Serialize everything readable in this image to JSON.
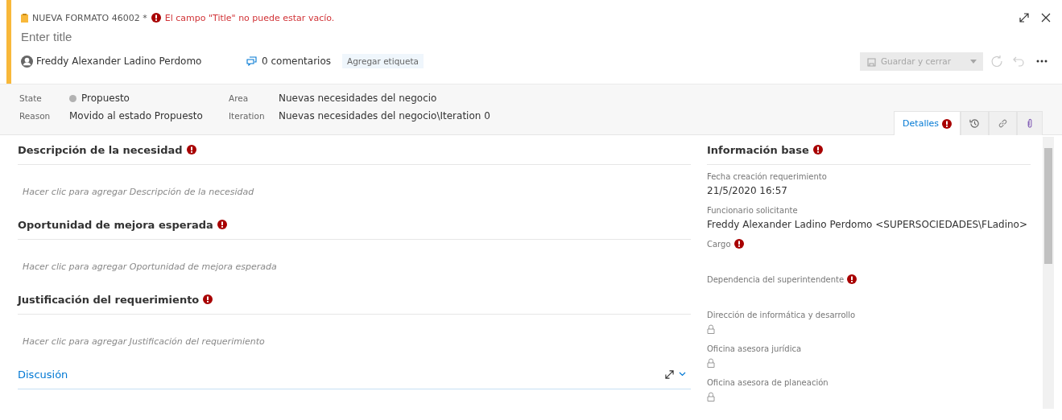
{
  "header": {
    "work_item_label": "NUEVA FORMATO 46002 *",
    "error": "El campo \"Title\" no puede estar vacío.",
    "title_placeholder": "Enter title",
    "assigned_to": "Freddy Alexander Ladino Perdomo",
    "comments": "0 comentarios",
    "add_tag": "Agregar etiqueta",
    "save_button": {
      "label": "Guardar y cerrar",
      "disabled": true
    }
  },
  "fields": [
    {
      "label": "State",
      "value": "Propuesto",
      "kind": "state",
      "color": "#b2b2b2"
    },
    {
      "label": "Area",
      "value": "Nuevas necesidades del negocio",
      "kind": "text"
    },
    {
      "label": "Reason",
      "value": "Movido al estado Propuesto",
      "kind": "text"
    },
    {
      "label": "Iteration",
      "value": "Nuevas necesidades del negocio\\Iteration 0",
      "kind": "text"
    }
  ],
  "tabs": [
    {
      "kind": "text",
      "label": "Detalles",
      "error": true,
      "selected": true
    },
    {
      "kind": "history",
      "selected": false
    },
    {
      "kind": "links",
      "selected": false
    },
    {
      "kind": "attachments",
      "selected": false
    }
  ],
  "sections": [
    {
      "title": "Descripción de la necesidad",
      "required": true,
      "placeholder": "Hacer clic para agregar Descripción de la necesidad"
    },
    {
      "title": "Oportunidad de mejora esperada",
      "required": true,
      "placeholder": "Hacer clic para agregar Oportunidad de mejora esperada"
    },
    {
      "title": "Justificación del requerimiento",
      "required": true,
      "placeholder": "Hacer clic para agregar Justificación del requerimiento"
    }
  ],
  "discussion": {
    "title": "Discusión"
  },
  "info": {
    "title": "Información base",
    "required": true,
    "fields": [
      {
        "label": "Fecha creación requerimiento",
        "value": "21/5/2020 16:57",
        "required": false,
        "locked": false
      },
      {
        "label": "Funcionario solicitante",
        "value": "Freddy Alexander Ladino Perdomo <SUPERSOCIEDADES\\FLadino>",
        "required": false,
        "locked": false
      },
      {
        "label": "Cargo",
        "required": true,
        "locked": false
      },
      {
        "label": "Dependencia del superintendente",
        "required": true,
        "locked": false
      },
      {
        "label": "Dirección de informática y desarrollo",
        "required": false,
        "locked": true
      },
      {
        "label": "Oficina asesora jurídica",
        "required": false,
        "locked": true
      },
      {
        "label": "Oficina asesora de planeación",
        "required": false,
        "locked": true
      }
    ]
  }
}
